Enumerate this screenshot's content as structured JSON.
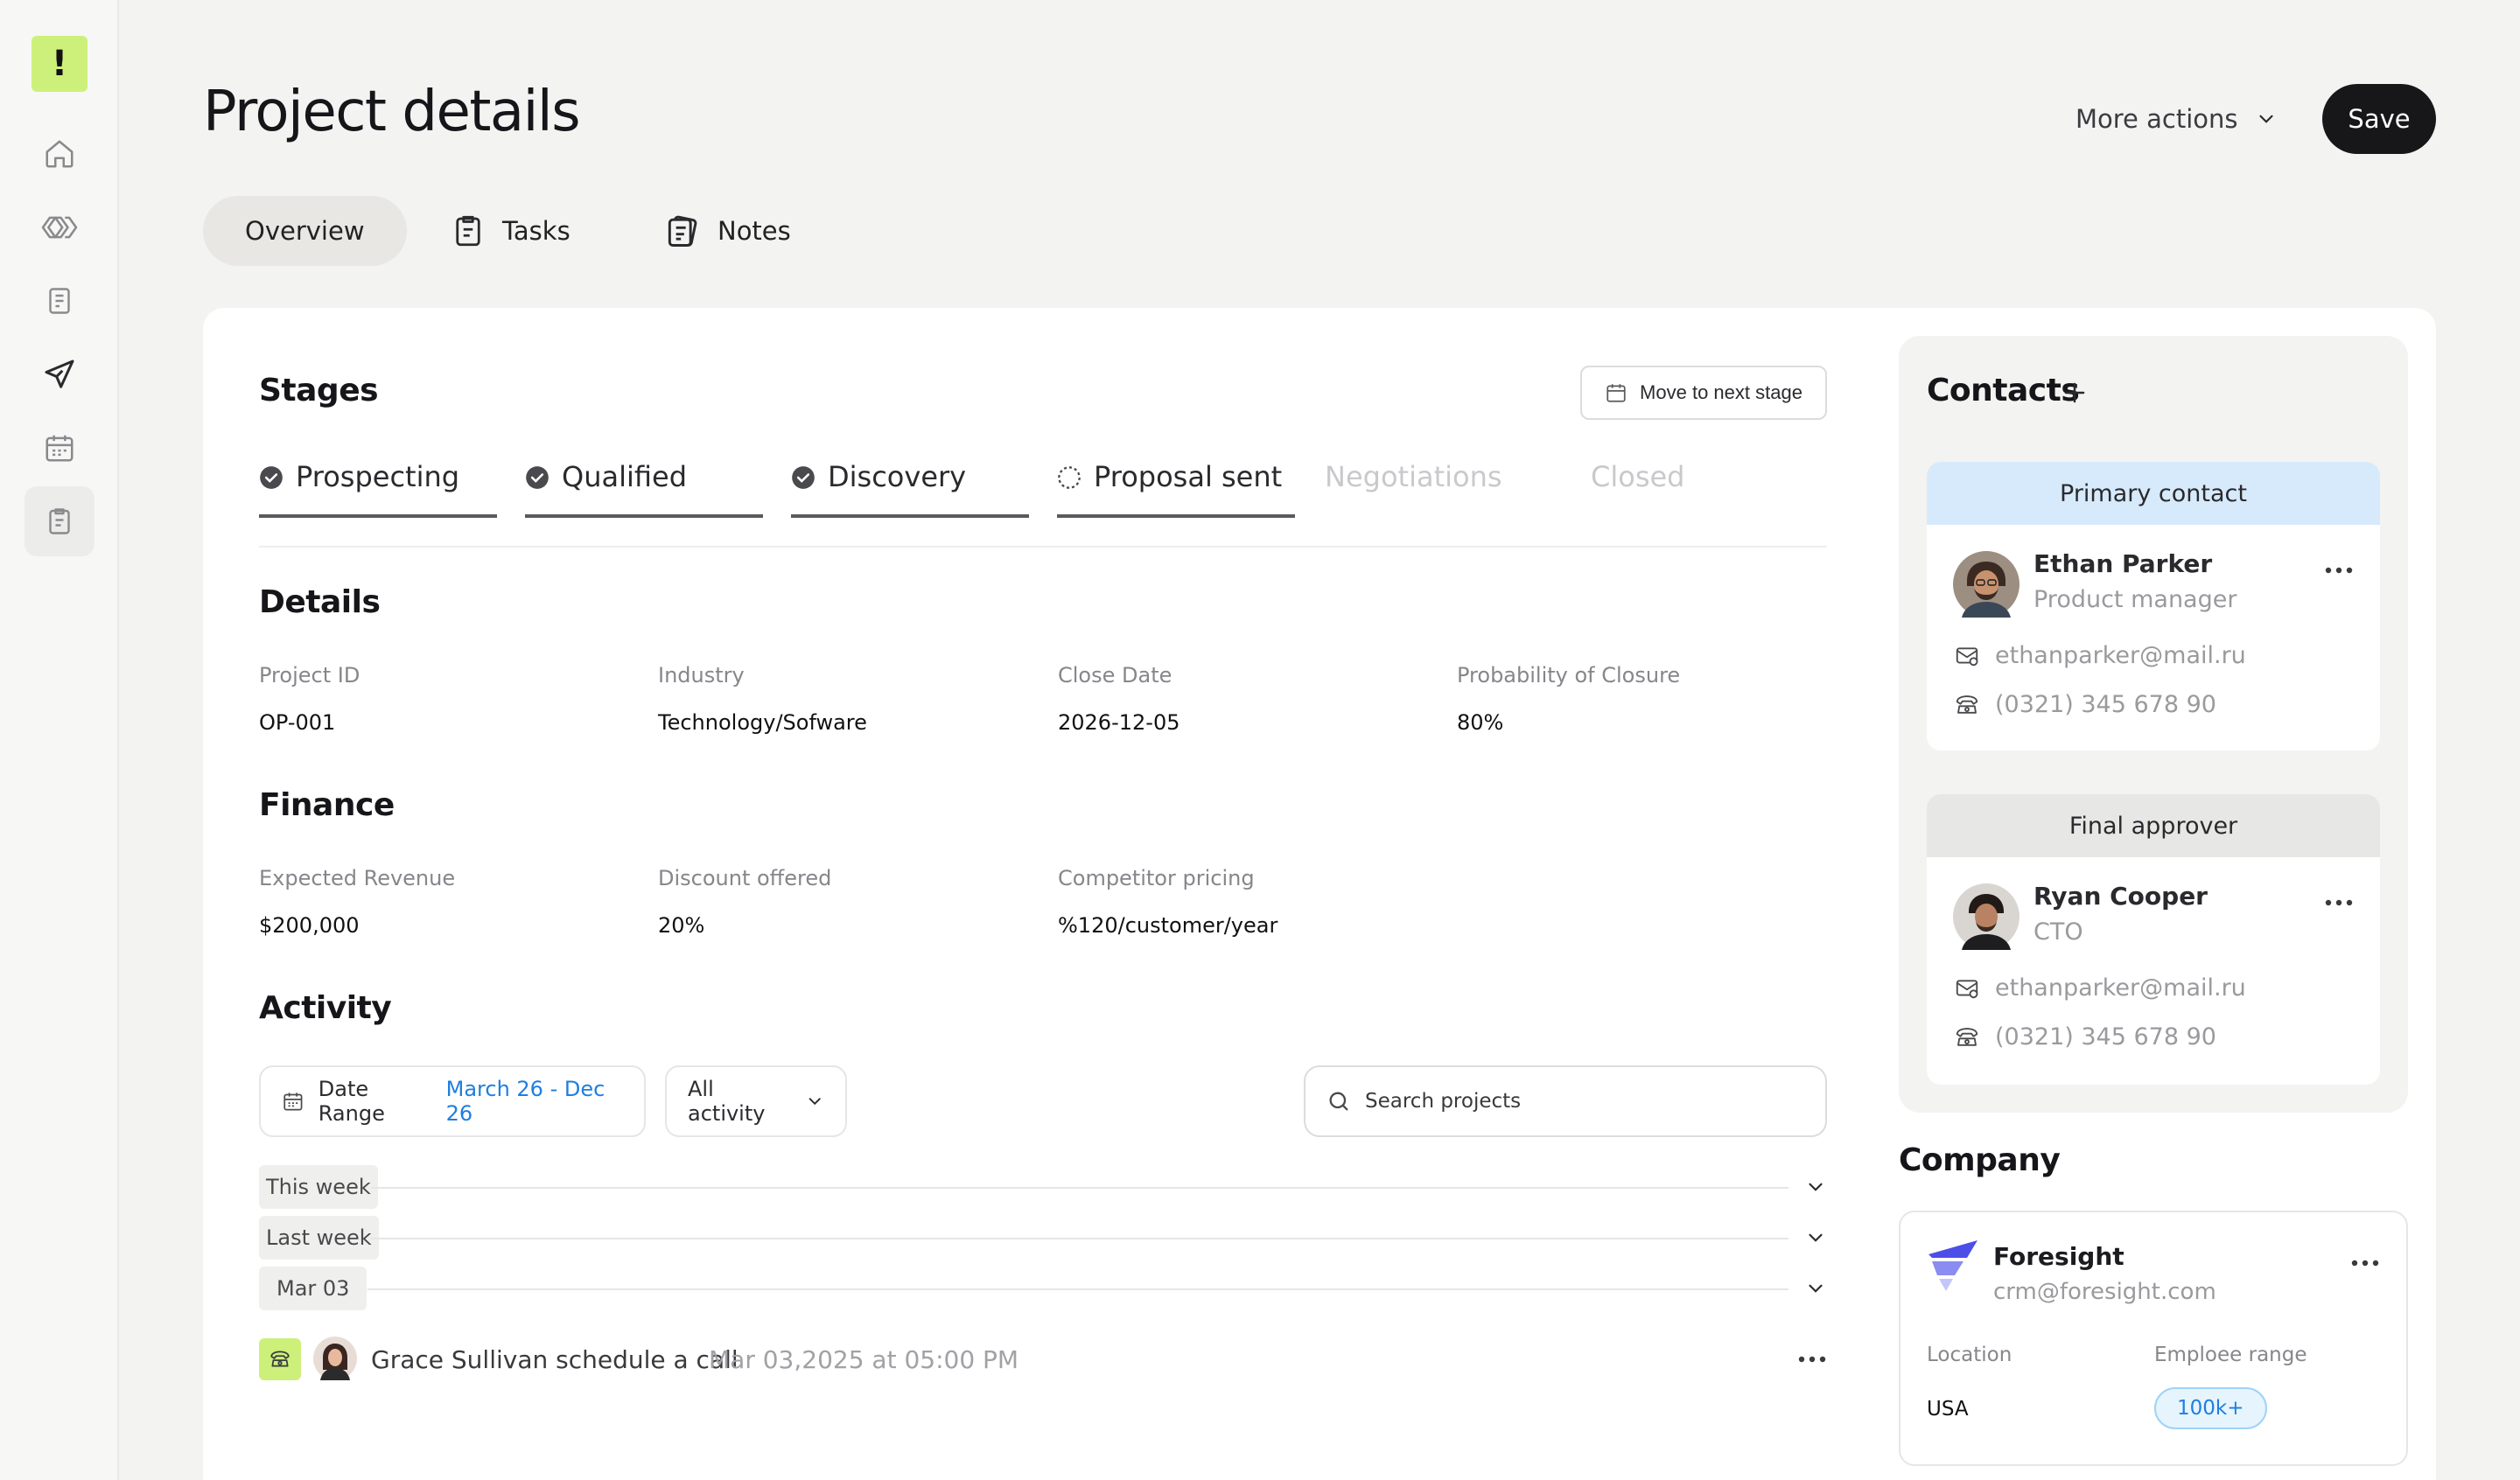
{
  "app": {
    "logo_text": "!"
  },
  "sidebar": {
    "items": [
      {
        "name": "home",
        "icon": "home-icon"
      },
      {
        "name": "pipeline",
        "icon": "chevrons-icon"
      },
      {
        "name": "invoices",
        "icon": "receipt-icon"
      },
      {
        "name": "campaigns",
        "icon": "send-icon"
      },
      {
        "name": "calendar",
        "icon": "calendar-icon"
      },
      {
        "name": "projects",
        "icon": "clipboard-icon",
        "active": true
      }
    ]
  },
  "header": {
    "title": "Project details",
    "more_actions_label": "More actions",
    "save_label": "Save"
  },
  "tabs": [
    {
      "label": "Overview",
      "active": true
    },
    {
      "label": "Tasks",
      "icon": "clipboard-icon"
    },
    {
      "label": "Notes",
      "icon": "notes-icon"
    }
  ],
  "stages": {
    "title": "Stages",
    "move_button_label": "Move to next stage",
    "items": [
      {
        "label": "Prospecting",
        "status": "done"
      },
      {
        "label": "Qualified",
        "status": "done"
      },
      {
        "label": "Discovery",
        "status": "done"
      },
      {
        "label": "Proposal sent",
        "status": "in-progress"
      },
      {
        "label": "Negotiations",
        "status": "pending"
      },
      {
        "label": "Closed",
        "status": "pending"
      }
    ]
  },
  "details": {
    "title": "Details",
    "fields": [
      {
        "label": "Project ID",
        "value": "OP-001"
      },
      {
        "label": "Industry",
        "value": "Technology/Sofware"
      },
      {
        "label": "Close Date",
        "value": "2026-12-05"
      },
      {
        "label": "Probability of Closure",
        "value": "80%"
      }
    ]
  },
  "finance": {
    "title": "Finance",
    "fields": [
      {
        "label": "Expected Revenue",
        "value": "$200,000"
      },
      {
        "label": "Discount offered",
        "value": "20%"
      },
      {
        "label": "Competitor pricing",
        "value": "%120/customer/year"
      }
    ]
  },
  "activity": {
    "title": "Activity",
    "date_range_label": "Date Range",
    "date_range_value": "March 26 - Dec 26",
    "filter_label": "All activity",
    "search_placeholder": "Search projects",
    "periods": [
      "This week",
      "Last week",
      "Mar 03"
    ],
    "item": {
      "text": "Grace Sullivan schedule a call",
      "time": "Mar 03,2025 at 05:00 PM"
    }
  },
  "contacts": {
    "title": "Contacts",
    "cards": [
      {
        "header": "Primary contact",
        "name": "Ethan Parker",
        "role": "Product manager",
        "email": "ethanparker@mail.ru",
        "phone": "(0321) 345 678 90"
      },
      {
        "header": "Final approver",
        "name": "Ryan Cooper",
        "role": "CTO",
        "email": "ethanparker@mail.ru",
        "phone": "(0321) 345 678 90"
      }
    ]
  },
  "company": {
    "title": "Company",
    "name": "Foresight",
    "email": "crm@foresight.com",
    "location_label": "Location",
    "location_value": "USA",
    "range_label": "Emploee range",
    "range_value": "100k+"
  },
  "colors": {
    "accent_lime": "#cdf07b",
    "link_blue": "#1f7ee0",
    "primary_contact_bg": "#d7eafc",
    "dark_button": "#17171a"
  }
}
